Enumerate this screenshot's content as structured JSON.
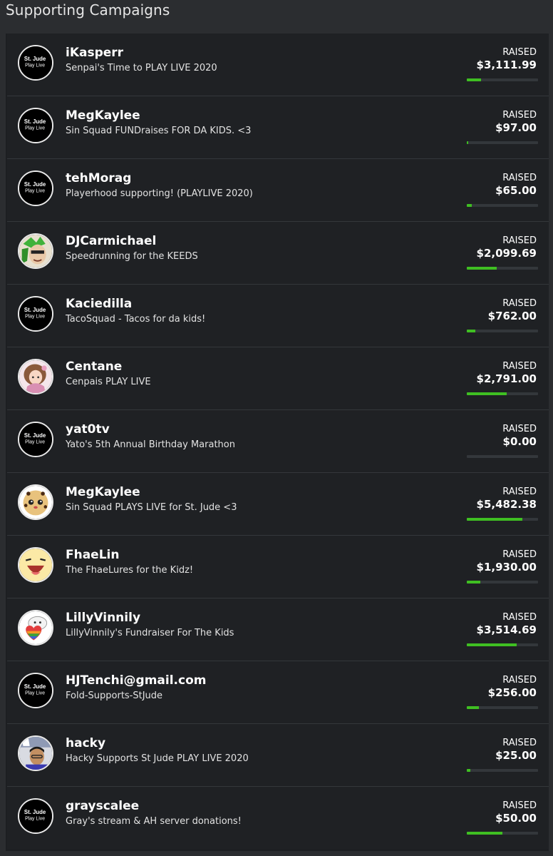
{
  "page": {
    "title": "Supporting Campaigns"
  },
  "colors": {
    "background": "#2b2d30",
    "panel": "#1d1f22",
    "progress_fill": "#3fbf22",
    "progress_track": "#33373b"
  },
  "campaigns": [
    {
      "name": "iKasperr",
      "subtitle": "Senpai's Time to PLAY LIVE 2020",
      "raised_label": "RAISED",
      "amount": "$3,111.99",
      "progress": 0.2,
      "avatar": "stjude-logo",
      "logo_line1": "St. Jude",
      "logo_line2": "Play Live"
    },
    {
      "name": "MegKaylee",
      "subtitle": "Sin Squad FUNDraises FOR DA KIDS. <3",
      "raised_label": "RAISED",
      "amount": "$97.00",
      "progress": 0.02,
      "avatar": "stjude-logo",
      "logo_line1": "St. Jude",
      "logo_line2": "Play Live"
    },
    {
      "name": "tehMorag",
      "subtitle": "Playerhood supporting! (PLAYLIVE 2020)",
      "raised_label": "RAISED",
      "amount": "$65.00",
      "progress": 0.07,
      "avatar": "stjude-logo",
      "logo_line1": "St. Jude",
      "logo_line2": "Play Live"
    },
    {
      "name": "DJCarmichael",
      "subtitle": "Speedrunning for the KEEDS",
      "raised_label": "RAISED",
      "amount": "$2,099.69",
      "progress": 0.42,
      "avatar": "green-hair-portrait"
    },
    {
      "name": "Kaciedilla",
      "subtitle": "TacoSquad - Tacos for da kids!",
      "raised_label": "RAISED",
      "amount": "$762.00",
      "progress": 0.12,
      "avatar": "stjude-logo",
      "logo_line1": "St. Jude",
      "logo_line2": "Play Live"
    },
    {
      "name": "Centane",
      "subtitle": "Cenpais PLAY LIVE",
      "raised_label": "RAISED",
      "amount": "$2,791.00",
      "progress": 0.56,
      "avatar": "anime-girl-portrait"
    },
    {
      "name": "yat0tv",
      "subtitle": "Yato's 5th Annual Birthday Marathon",
      "raised_label": "RAISED",
      "amount": "$0.00",
      "progress": 0.0,
      "avatar": "stjude-logo",
      "logo_line1": "St. Jude",
      "logo_line2": "Play Live"
    },
    {
      "name": "MegKaylee",
      "subtitle": "Sin Squad PLAYS LIVE for St. Jude <3",
      "raised_label": "RAISED",
      "amount": "$5,482.38",
      "progress": 0.78,
      "avatar": "cookie-face"
    },
    {
      "name": "FhaeLin",
      "subtitle": "The FhaeLures for the Kidz!",
      "raised_label": "RAISED",
      "amount": "$1,930.00",
      "progress": 0.19,
      "avatar": "laughing-face"
    },
    {
      "name": "LillyVinnily",
      "subtitle": "LillyVinnily's Fundraiser For The Kids",
      "raised_label": "RAISED",
      "amount": "$3,514.69",
      "progress": 0.7,
      "avatar": "rainbow-heart"
    },
    {
      "name": "HJTenchi@gmail.com",
      "subtitle": "Fold-Supports-StJude",
      "raised_label": "RAISED",
      "amount": "$256.00",
      "progress": 0.17,
      "avatar": "stjude-logo",
      "logo_line1": "St. Jude",
      "logo_line2": "Play Live"
    },
    {
      "name": "hacky",
      "subtitle": "Hacky Supports St Jude PLAY LIVE 2020",
      "raised_label": "RAISED",
      "amount": "$25.00",
      "progress": 0.05,
      "avatar": "person-photo"
    },
    {
      "name": "grayscalee",
      "subtitle": "Gray's stream & AH server donations!",
      "raised_label": "RAISED",
      "amount": "$50.00",
      "progress": 0.5,
      "avatar": "stjude-logo",
      "logo_line1": "St. Jude",
      "logo_line2": "Play Live"
    }
  ]
}
